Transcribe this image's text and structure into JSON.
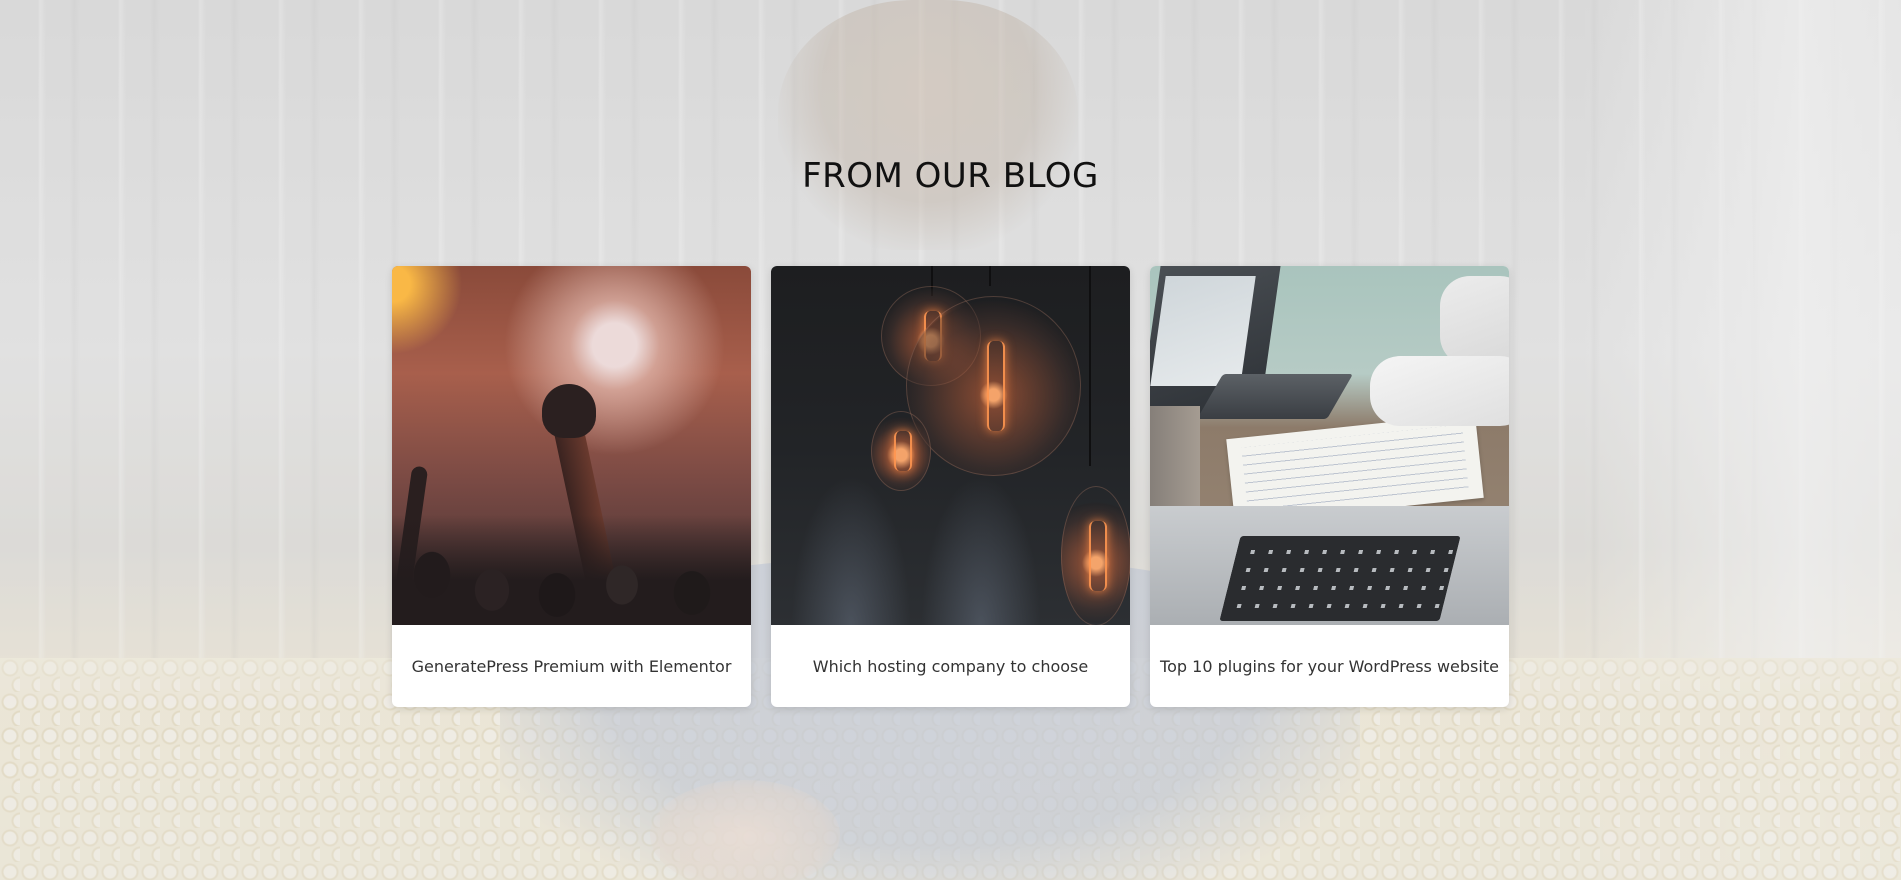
{
  "section": {
    "title": "FROM OUR BLOG"
  },
  "posts": [
    {
      "title": "GeneratePress Premium with Elementor",
      "image": "concert-crowd-photo"
    },
    {
      "title": "Which hosting company to choose",
      "image": "edison-light-bulbs-photo"
    },
    {
      "title": "Top 10 plugins for your WordPress website",
      "image": "laptops-on-desk-photo"
    }
  ],
  "colors": {
    "title_text": "#111111",
    "card_bg": "#ffffff",
    "card_text": "#333333"
  }
}
